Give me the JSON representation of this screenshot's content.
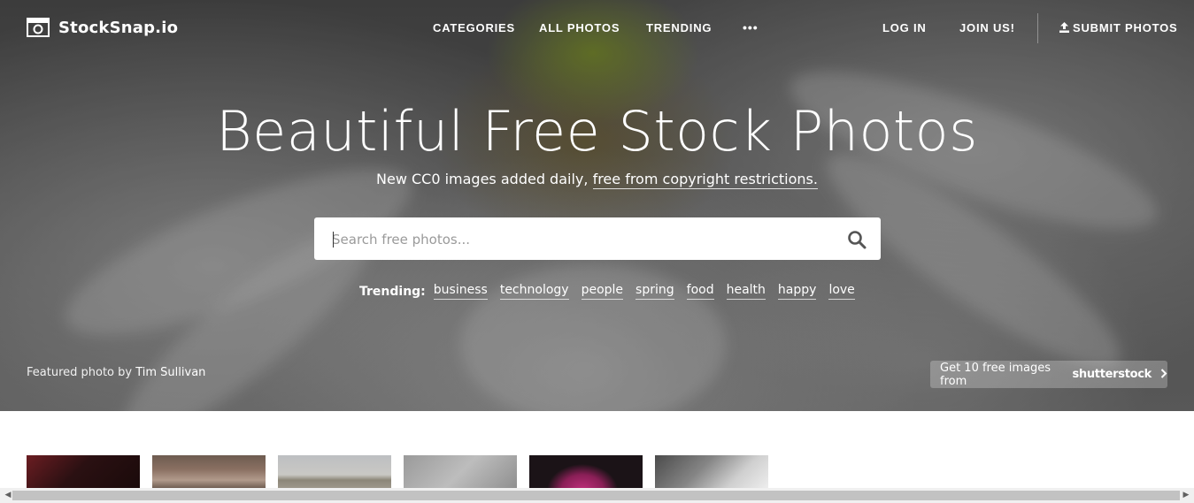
{
  "logo": {
    "text": "StockSnap.io",
    "icon": "camera-logo-icon"
  },
  "nav": {
    "categories": "CATEGORIES",
    "all_photos": "ALL PHOTOS",
    "trending": "TRENDING",
    "more": "•••",
    "login": "LOG IN",
    "join": "JOIN US!",
    "submit": "SUBMIT PHOTOS",
    "submit_icon": "upload-icon"
  },
  "hero": {
    "title": "Beautiful Free Stock Photos",
    "subtitle_prefix": "New CC0 images added daily,",
    "subtitle_link": "free from copyright restrictions."
  },
  "search": {
    "placeholder": "Search free photos...",
    "icon": "search-icon"
  },
  "trending": {
    "label": "Trending:",
    "tags": [
      "business",
      "technology",
      "people",
      "spring",
      "food",
      "health",
      "happy",
      "love"
    ]
  },
  "credit": {
    "prefix": "Featured photo by",
    "author": "Tim Sullivan"
  },
  "shutterstock": {
    "text": "Get 10 free images from",
    "brand": "shutterstock",
    "icon": "chevron-right-icon"
  },
  "thumbnails": {
    "count_visible": 6
  },
  "colors": {
    "hero_text": "#ffffff",
    "page_bg": "#ffffff"
  }
}
